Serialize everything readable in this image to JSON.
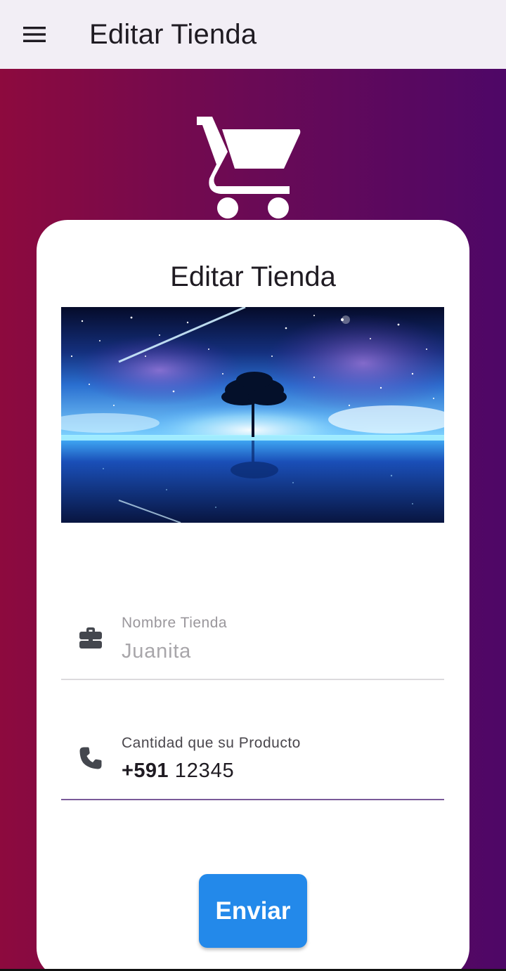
{
  "appbar": {
    "menu_icon": "menu-icon",
    "title": "Editar Tienda"
  },
  "header_icon": "shopping-cart-icon",
  "card": {
    "title": "Editar Tienda",
    "banner": "starry-night-tree-image"
  },
  "form": {
    "store_name": {
      "icon": "briefcase-icon",
      "label": "Nombre Tienda",
      "value": "Juanita"
    },
    "quantity": {
      "icon": "phone-icon",
      "label": "Cantidad que su Producto",
      "prefix": "+591",
      "value": "12345"
    },
    "submit_label": "Enviar"
  },
  "colors": {
    "gradient_start": "#8d0a3e",
    "gradient_end": "#4e0767",
    "appbar_bg": "#f2eef5",
    "button_bg": "#2389ea",
    "focused_underline": "#7a5a99"
  }
}
